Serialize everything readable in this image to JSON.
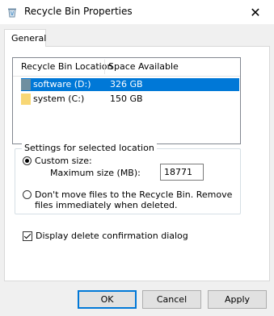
{
  "window": {
    "title": "Recycle Bin Properties",
    "close_glyph": "✕"
  },
  "tabs": [
    {
      "label": "General"
    }
  ],
  "list": {
    "columns": [
      "Recycle Bin Location",
      "Space Available"
    ],
    "rows": [
      {
        "name": "software (D:)",
        "space": "326 GB",
        "selected": true
      },
      {
        "name": "system (C:)",
        "space": "150 GB",
        "selected": false
      }
    ]
  },
  "settings": {
    "legend": "Settings for selected location",
    "custom_label": "Custom size:",
    "max_label": "Maximum size (MB):",
    "max_value": "18771",
    "dont_move_label": "Don't move files to the Recycle Bin. Remove files immediately when deleted.",
    "selected_option": "custom"
  },
  "confirm": {
    "label": "Display delete confirmation dialog",
    "checked": true
  },
  "buttons": {
    "ok": "OK",
    "cancel": "Cancel",
    "apply": "Apply"
  },
  "colors": {
    "accent": "#0078d7",
    "drive_folder": "#f8d775",
    "drive_selected": "#6f8fa0"
  }
}
